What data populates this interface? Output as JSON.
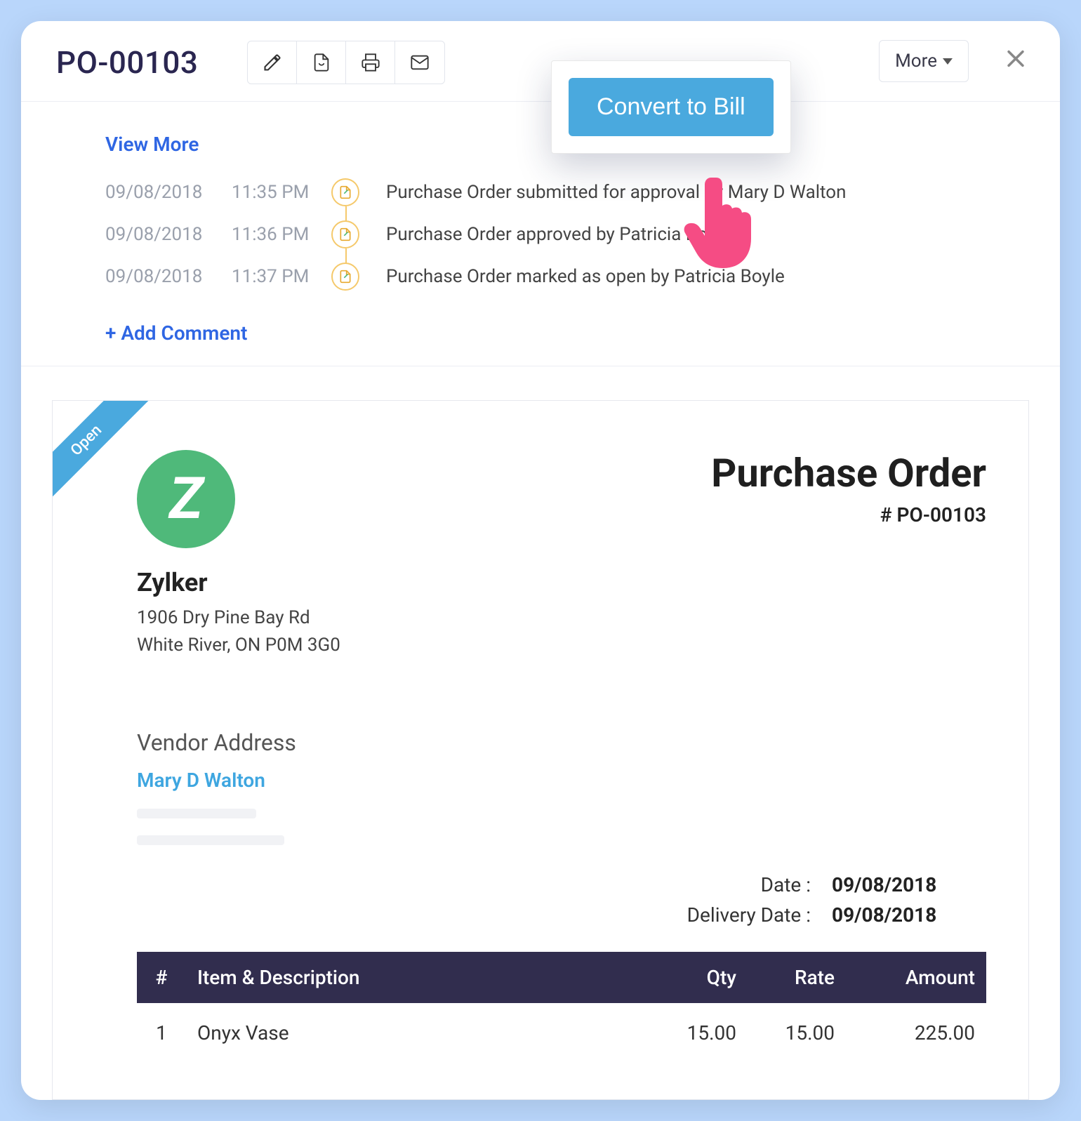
{
  "header": {
    "title": "PO-00103",
    "more_label": "More",
    "convert_label": "Convert to Bill"
  },
  "timeline": {
    "view_more": "View More",
    "add_comment": "+  Add Comment",
    "entries": [
      {
        "date": "09/08/2018",
        "time": "11:35 PM",
        "text": "Purchase Order submitted for approval by Mary D Walton"
      },
      {
        "date": "09/08/2018",
        "time": "11:36 PM",
        "text": "Purchase Order approved by Patricia Boyle"
      },
      {
        "date": "09/08/2018",
        "time": "11:37 PM",
        "text": "Purchase Order marked as open by Patricia Boyle"
      }
    ]
  },
  "document": {
    "ribbon": "Open",
    "logo_letter": "Z",
    "company": "Zylker",
    "address_line1": "1906 Dry Pine Bay Rd",
    "address_line2": "White River, ON P0M 3G0",
    "title": "Purchase Order",
    "number": "# PO-00103",
    "vendor_heading": "Vendor Address",
    "vendor_name": "Mary D Walton",
    "meta": {
      "date_label": "Date :",
      "date_value": "09/08/2018",
      "delivery_label": "Delivery Date :",
      "delivery_value": "09/08/2018"
    },
    "columns": {
      "num": "#",
      "item": "Item & Description",
      "qty": "Qty",
      "rate": "Rate",
      "amount": "Amount"
    },
    "items": [
      {
        "num": "1",
        "desc": "Onyx Vase",
        "qty": "15.00",
        "rate": "15.00",
        "amount": "225.00"
      }
    ]
  }
}
